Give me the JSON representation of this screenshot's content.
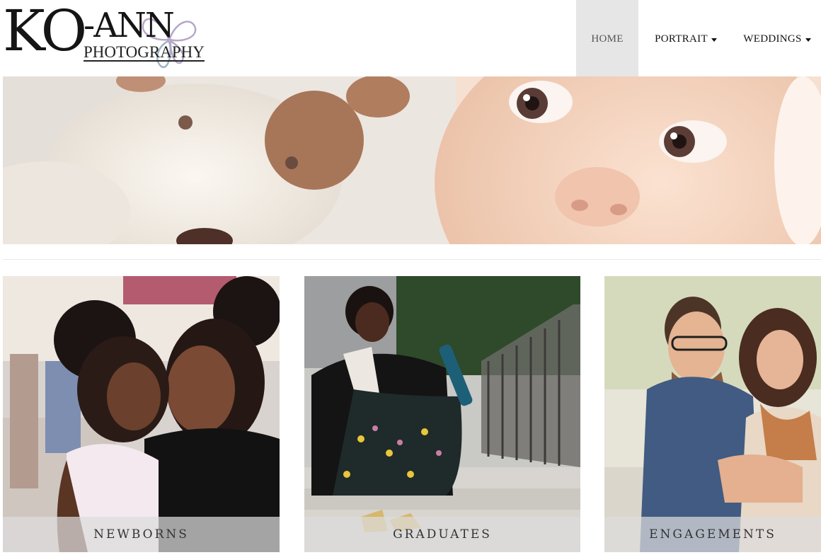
{
  "logo": {
    "main": "KO",
    "ann": "-ANN",
    "sub": "PHOTOGRAPHY"
  },
  "nav": {
    "items": [
      {
        "label": "HOME",
        "active": true
      },
      {
        "label": "PORTRAIT",
        "dropdown": true
      },
      {
        "label": "WEDDINGS",
        "dropdown": true
      }
    ]
  },
  "icons": {
    "caret": "chevron-down-icon"
  },
  "cards": [
    {
      "caption": "NEWBORNS"
    },
    {
      "caption": "GRADUATES"
    },
    {
      "caption": "ENGAGEMENTS"
    }
  ],
  "colors": {
    "nav_active_bg": "#e6e6e6",
    "caption_overlay": "rgba(220,220,220,0.72)"
  }
}
